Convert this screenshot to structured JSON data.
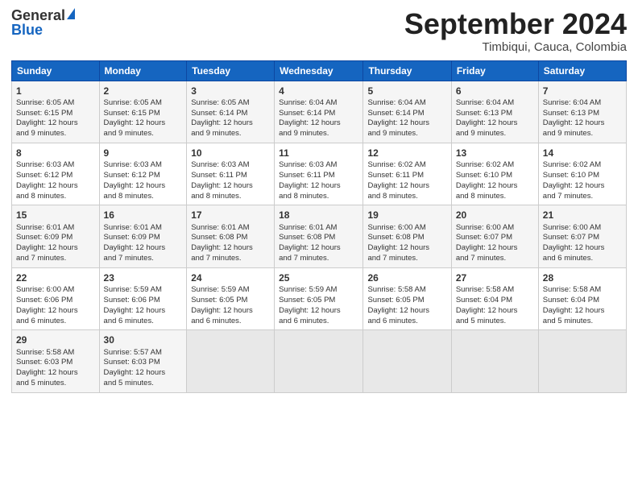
{
  "logo": {
    "line1": "General",
    "line2": "Blue"
  },
  "header": {
    "month": "September 2024",
    "location": "Timbiqui, Cauca, Colombia"
  },
  "days": [
    "Sunday",
    "Monday",
    "Tuesday",
    "Wednesday",
    "Thursday",
    "Friday",
    "Saturday"
  ],
  "weeks": [
    [
      {
        "day": 1,
        "lines": [
          "Sunrise: 6:05 AM",
          "Sunset: 6:15 PM",
          "Daylight: 12 hours",
          "and 9 minutes."
        ]
      },
      {
        "day": 2,
        "lines": [
          "Sunrise: 6:05 AM",
          "Sunset: 6:15 PM",
          "Daylight: 12 hours",
          "and 9 minutes."
        ]
      },
      {
        "day": 3,
        "lines": [
          "Sunrise: 6:05 AM",
          "Sunset: 6:14 PM",
          "Daylight: 12 hours",
          "and 9 minutes."
        ]
      },
      {
        "day": 4,
        "lines": [
          "Sunrise: 6:04 AM",
          "Sunset: 6:14 PM",
          "Daylight: 12 hours",
          "and 9 minutes."
        ]
      },
      {
        "day": 5,
        "lines": [
          "Sunrise: 6:04 AM",
          "Sunset: 6:14 PM",
          "Daylight: 12 hours",
          "and 9 minutes."
        ]
      },
      {
        "day": 6,
        "lines": [
          "Sunrise: 6:04 AM",
          "Sunset: 6:13 PM",
          "Daylight: 12 hours",
          "and 9 minutes."
        ]
      },
      {
        "day": 7,
        "lines": [
          "Sunrise: 6:04 AM",
          "Sunset: 6:13 PM",
          "Daylight: 12 hours",
          "and 9 minutes."
        ]
      }
    ],
    [
      {
        "day": 8,
        "lines": [
          "Sunrise: 6:03 AM",
          "Sunset: 6:12 PM",
          "Daylight: 12 hours",
          "and 8 minutes."
        ]
      },
      {
        "day": 9,
        "lines": [
          "Sunrise: 6:03 AM",
          "Sunset: 6:12 PM",
          "Daylight: 12 hours",
          "and 8 minutes."
        ]
      },
      {
        "day": 10,
        "lines": [
          "Sunrise: 6:03 AM",
          "Sunset: 6:11 PM",
          "Daylight: 12 hours",
          "and 8 minutes."
        ]
      },
      {
        "day": 11,
        "lines": [
          "Sunrise: 6:03 AM",
          "Sunset: 6:11 PM",
          "Daylight: 12 hours",
          "and 8 minutes."
        ]
      },
      {
        "day": 12,
        "lines": [
          "Sunrise: 6:02 AM",
          "Sunset: 6:11 PM",
          "Daylight: 12 hours",
          "and 8 minutes."
        ]
      },
      {
        "day": 13,
        "lines": [
          "Sunrise: 6:02 AM",
          "Sunset: 6:10 PM",
          "Daylight: 12 hours",
          "and 8 minutes."
        ]
      },
      {
        "day": 14,
        "lines": [
          "Sunrise: 6:02 AM",
          "Sunset: 6:10 PM",
          "Daylight: 12 hours",
          "and 7 minutes."
        ]
      }
    ],
    [
      {
        "day": 15,
        "lines": [
          "Sunrise: 6:01 AM",
          "Sunset: 6:09 PM",
          "Daylight: 12 hours",
          "and 7 minutes."
        ]
      },
      {
        "day": 16,
        "lines": [
          "Sunrise: 6:01 AM",
          "Sunset: 6:09 PM",
          "Daylight: 12 hours",
          "and 7 minutes."
        ]
      },
      {
        "day": 17,
        "lines": [
          "Sunrise: 6:01 AM",
          "Sunset: 6:08 PM",
          "Daylight: 12 hours",
          "and 7 minutes."
        ]
      },
      {
        "day": 18,
        "lines": [
          "Sunrise: 6:01 AM",
          "Sunset: 6:08 PM",
          "Daylight: 12 hours",
          "and 7 minutes."
        ]
      },
      {
        "day": 19,
        "lines": [
          "Sunrise: 6:00 AM",
          "Sunset: 6:08 PM",
          "Daylight: 12 hours",
          "and 7 minutes."
        ]
      },
      {
        "day": 20,
        "lines": [
          "Sunrise: 6:00 AM",
          "Sunset: 6:07 PM",
          "Daylight: 12 hours",
          "and 7 minutes."
        ]
      },
      {
        "day": 21,
        "lines": [
          "Sunrise: 6:00 AM",
          "Sunset: 6:07 PM",
          "Daylight: 12 hours",
          "and 6 minutes."
        ]
      }
    ],
    [
      {
        "day": 22,
        "lines": [
          "Sunrise: 6:00 AM",
          "Sunset: 6:06 PM",
          "Daylight: 12 hours",
          "and 6 minutes."
        ]
      },
      {
        "day": 23,
        "lines": [
          "Sunrise: 5:59 AM",
          "Sunset: 6:06 PM",
          "Daylight: 12 hours",
          "and 6 minutes."
        ]
      },
      {
        "day": 24,
        "lines": [
          "Sunrise: 5:59 AM",
          "Sunset: 6:05 PM",
          "Daylight: 12 hours",
          "and 6 minutes."
        ]
      },
      {
        "day": 25,
        "lines": [
          "Sunrise: 5:59 AM",
          "Sunset: 6:05 PM",
          "Daylight: 12 hours",
          "and 6 minutes."
        ]
      },
      {
        "day": 26,
        "lines": [
          "Sunrise: 5:58 AM",
          "Sunset: 6:05 PM",
          "Daylight: 12 hours",
          "and 6 minutes."
        ]
      },
      {
        "day": 27,
        "lines": [
          "Sunrise: 5:58 AM",
          "Sunset: 6:04 PM",
          "Daylight: 12 hours",
          "and 5 minutes."
        ]
      },
      {
        "day": 28,
        "lines": [
          "Sunrise: 5:58 AM",
          "Sunset: 6:04 PM",
          "Daylight: 12 hours",
          "and 5 minutes."
        ]
      }
    ],
    [
      {
        "day": 29,
        "lines": [
          "Sunrise: 5:58 AM",
          "Sunset: 6:03 PM",
          "Daylight: 12 hours",
          "and 5 minutes."
        ]
      },
      {
        "day": 30,
        "lines": [
          "Sunrise: 5:57 AM",
          "Sunset: 6:03 PM",
          "Daylight: 12 hours",
          "and 5 minutes."
        ]
      },
      null,
      null,
      null,
      null,
      null
    ]
  ]
}
